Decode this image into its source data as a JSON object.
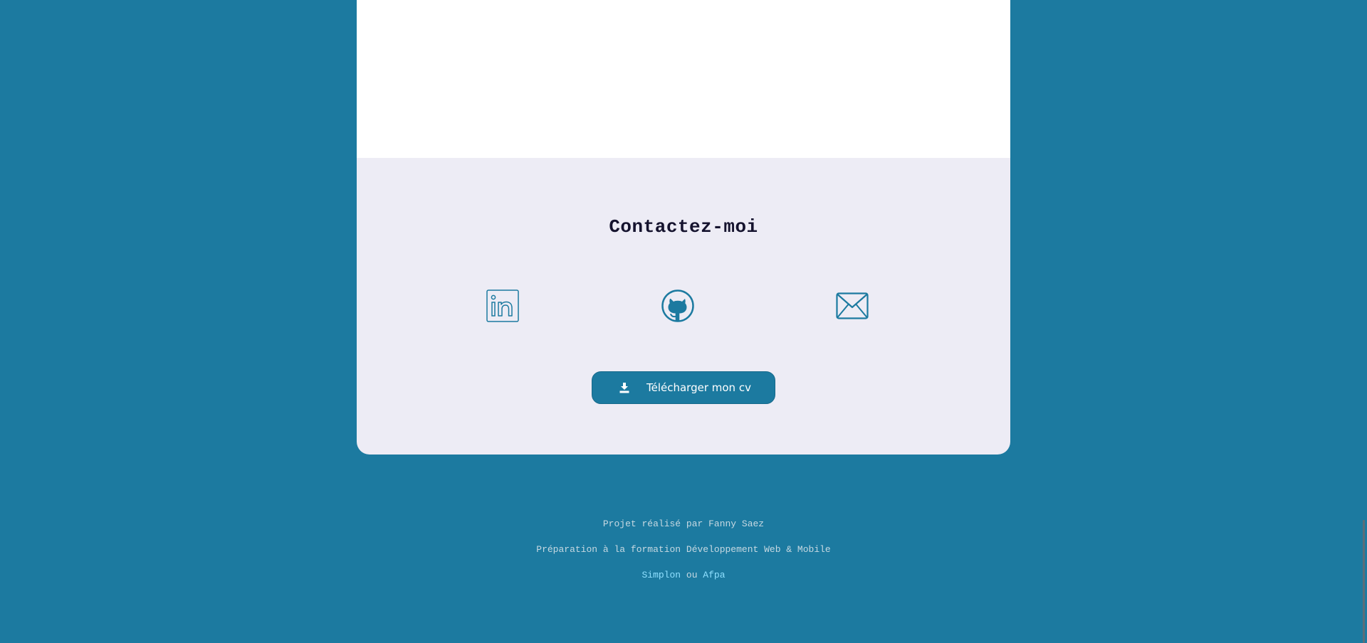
{
  "contact": {
    "title": "Contactez-moi",
    "icons": {
      "linkedin": "linkedin-icon",
      "github": "github-icon",
      "email": "envelope-icon"
    },
    "cv_button_label": "Télécharger mon cv"
  },
  "footer": {
    "line1": "Projet réalisé par Fanny Saez",
    "line2": "Préparation à la formation Développement Web & Mobile",
    "link_simplon": "Simplon",
    "separator": "ou",
    "link_afpa": "Afpa"
  },
  "colors": {
    "background": "#1c7aa0",
    "card": "#edecf5",
    "accent": "#1c7aa0",
    "title": "#15132e",
    "footer_text": "#c7d9e2",
    "footer_link": "#8fe0ff"
  }
}
